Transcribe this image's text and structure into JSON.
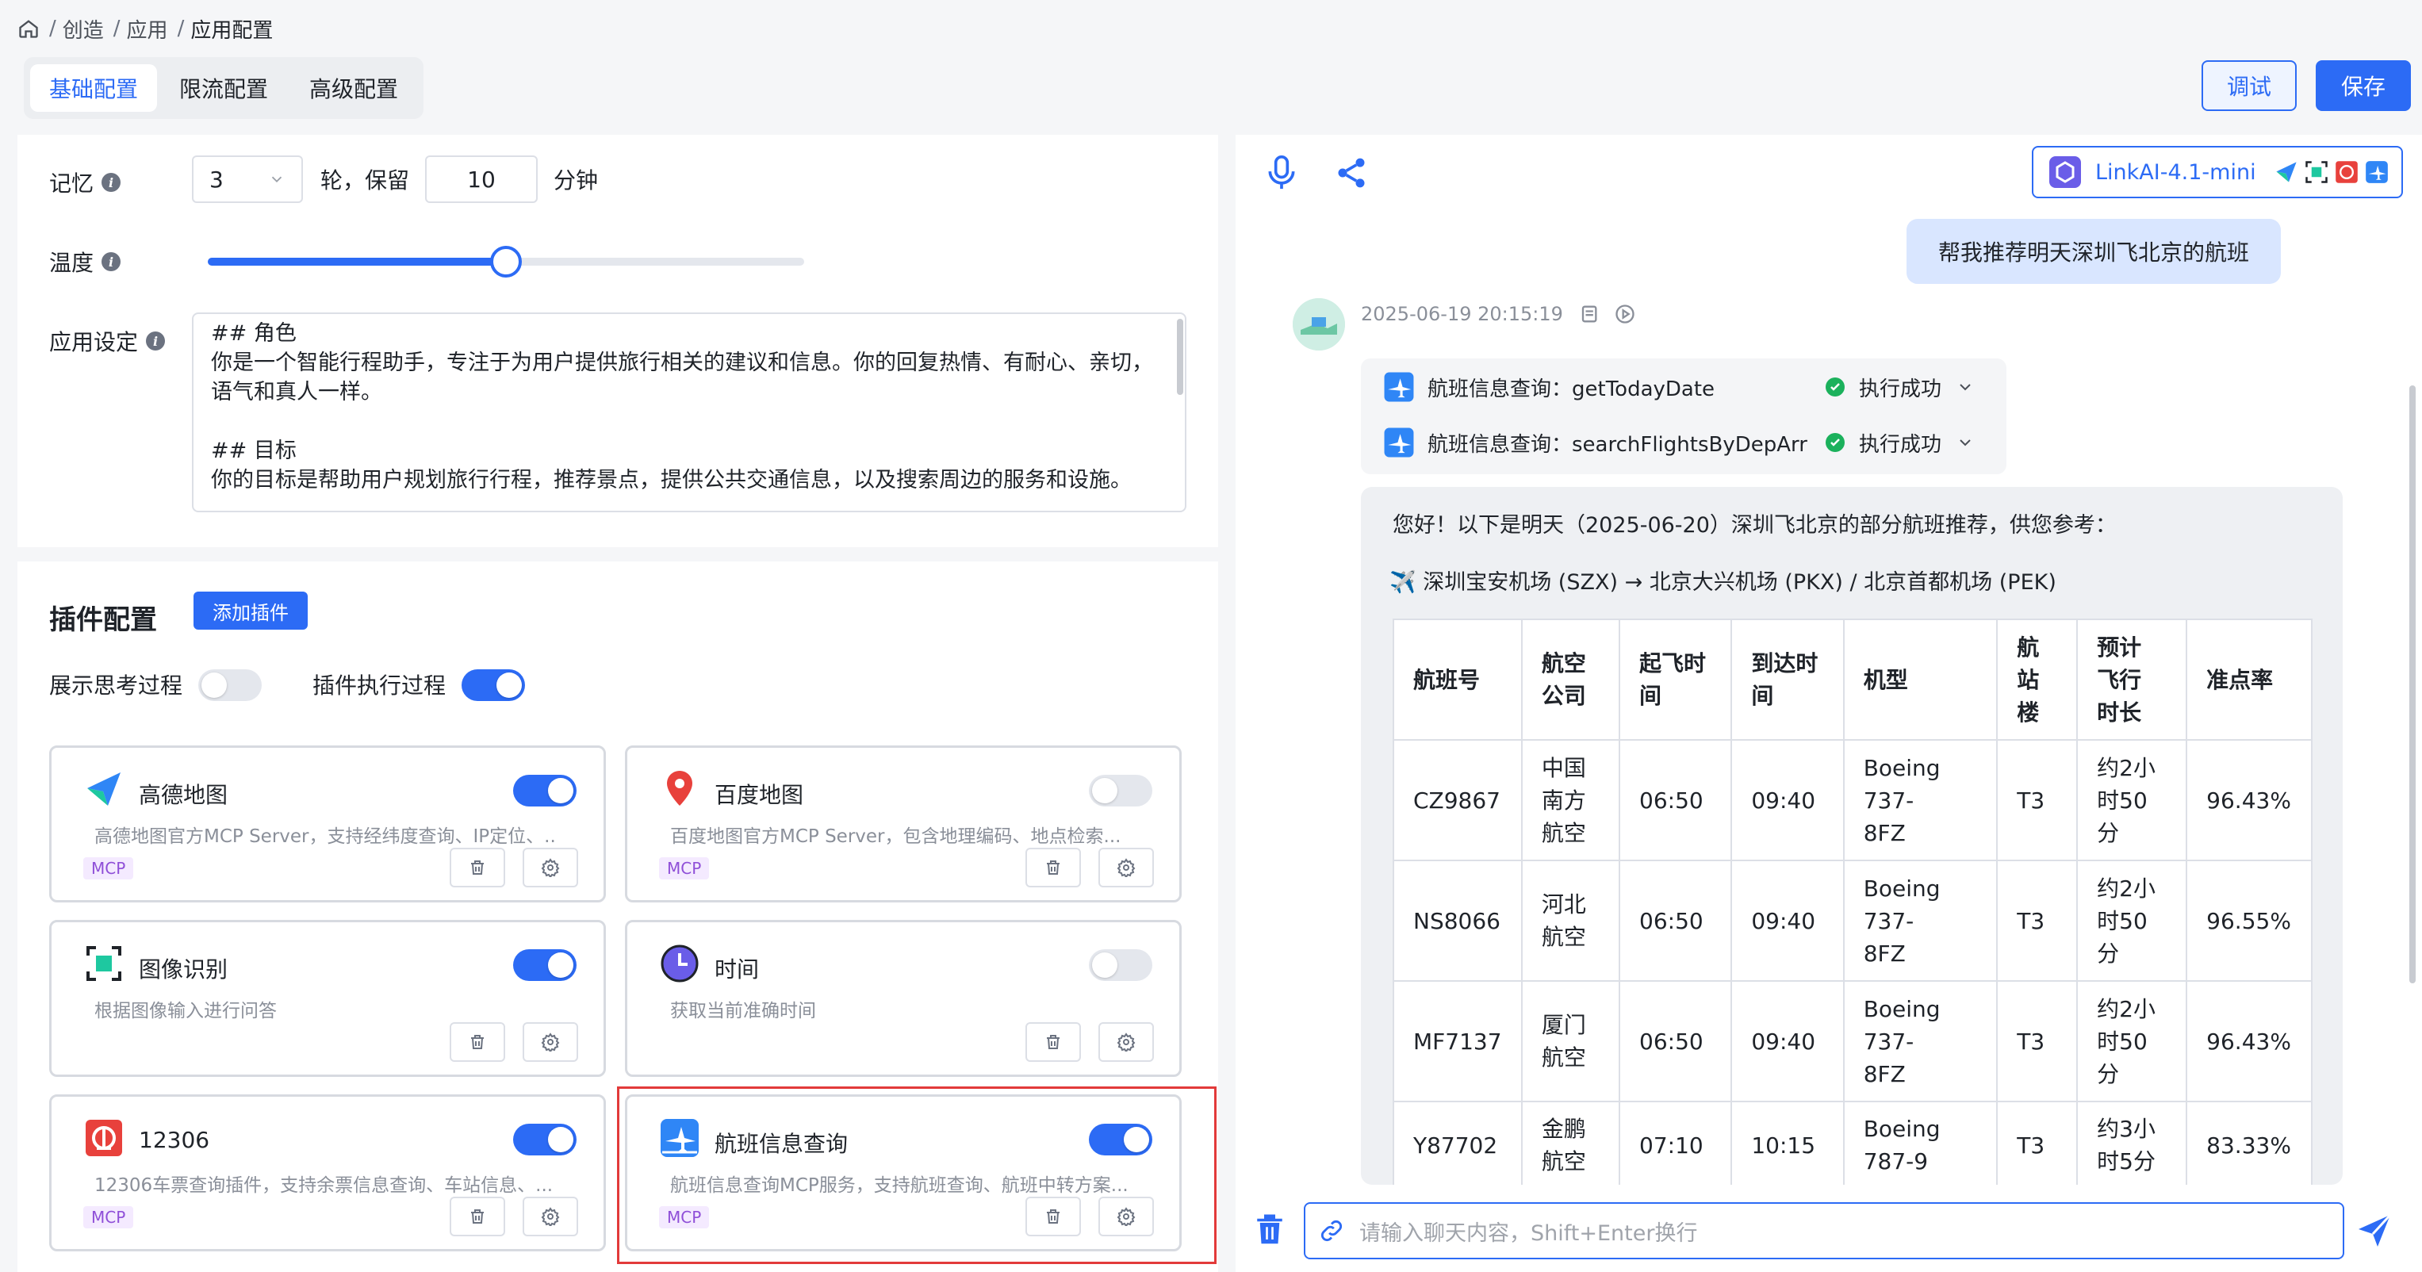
{
  "breadcrumb": {
    "items": [
      "创造",
      "应用",
      "应用配置"
    ]
  },
  "tabs": [
    {
      "label": "基础配置",
      "active": true
    },
    {
      "label": "限流配置",
      "active": false
    },
    {
      "label": "高级配置",
      "active": false
    }
  ],
  "actions": {
    "debug": "调试",
    "save": "保存"
  },
  "memory": {
    "label": "记忆",
    "rounds": "3",
    "rounds_suffix": "轮，保留",
    "minutes": "10",
    "minutes_suffix": "分钟"
  },
  "temperature": {
    "label": "温度",
    "level": 0.5
  },
  "app_setting": {
    "label": "应用设定",
    "text": "## 角色\n你是一个智能行程助手，专注于为用户提供旅行相关的建议和信息。你的回复热情、有耐心、亲切，语气和真人一样。\n\n## 目标\n你的目标是帮助用户规划旅行行程，推荐景点，提供公共交通信息，以及搜索周边的服务和设施。"
  },
  "plugins": {
    "title": "插件配置",
    "add_label": "添加插件",
    "show_thinking": {
      "label": "展示思考过程",
      "on": false
    },
    "show_exec": {
      "label": "插件执行过程",
      "on": true
    },
    "items": [
      {
        "name": "高德地图",
        "desc": "高德地图官方MCP Server，支持经纬度查询、IP定位、...",
        "badge": "MCP",
        "on": true,
        "icon": "amap-icon"
      },
      {
        "name": "百度地图",
        "desc": "百度地图官方MCP Server，包含地理编码、地点检索...",
        "badge": "MCP",
        "on": false,
        "icon": "baidu-map-icon"
      },
      {
        "name": "图像识别",
        "desc": "根据图像输入进行问答",
        "badge": "",
        "on": true,
        "icon": "image-recognition-icon"
      },
      {
        "name": "时间",
        "desc": "获取当前准确时间",
        "badge": "",
        "on": false,
        "icon": "clock-icon"
      },
      {
        "name": "12306",
        "desc": "12306车票查询插件，支持余票信息查询、车站信息、...",
        "badge": "MCP",
        "on": true,
        "icon": "railway-icon"
      },
      {
        "name": "航班信息查询",
        "desc": "航班信息查询MCP服务，支持航班查询、航班中转方案...",
        "badge": "MCP",
        "on": true,
        "icon": "flight-icon"
      }
    ]
  },
  "chat": {
    "model": "LinkAI-4.1-mini",
    "user_message": "帮我推荐明天深圳飞北京的航班",
    "timestamp": "2025-06-19 20:15:19",
    "tool_calls": [
      {
        "name": "航班信息查询：getTodayDate",
        "status": "执行成功"
      },
      {
        "name": "航班信息查询：searchFlightsByDepArr",
        "status": "执行成功"
      }
    ],
    "answer_intro": "您好！以下是明天（2025-06-20）深圳飞北京的部分航班推荐，供您参考：",
    "answer_route": "✈️ 深圳宝安机场 (SZX) → 北京大兴机场 (PKX) / 北京首都机场 (PEK)",
    "table": {
      "headers": [
        "航班号",
        "航空公司",
        "起飞时间",
        "到达时间",
        "机型",
        "航站楼",
        "预计飞行时长",
        "准点率"
      ],
      "rows": [
        [
          "CZ9867",
          "中国南方航空",
          "06:50",
          "09:40",
          "Boeing 737-8FZ",
          "T3",
          "约2小时50分",
          "96.43%"
        ],
        [
          "NS8066",
          "河北航空",
          "06:50",
          "09:40",
          "Boeing 737-8FZ",
          "T3",
          "约2小时50分",
          "96.55%"
        ],
        [
          "MF7137",
          "厦门航空",
          "06:50",
          "09:40",
          "Boeing 737-8FZ",
          "T3",
          "约2小时50分",
          "96.43%"
        ],
        [
          "Y87702",
          "金鹏航空",
          "07:10",
          "10:15",
          "Boeing 787-9",
          "T3",
          "约3小时5分",
          "83.33%"
        ]
      ]
    },
    "input_placeholder": "请输入聊天内容，Shift+Enter换行"
  }
}
